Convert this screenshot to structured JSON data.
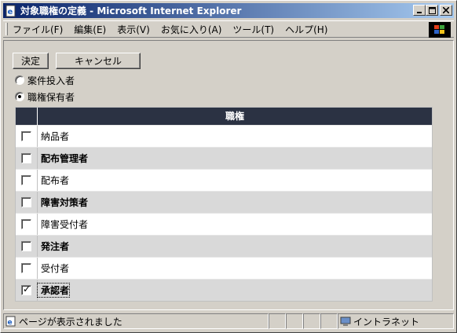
{
  "window": {
    "title": "対象職権の定義 - Microsoft Internet Explorer",
    "icon": "ie-page-icon"
  },
  "menubar": {
    "items": [
      "ファイル(F)",
      "編集(E)",
      "表示(V)",
      "お気に入り(A)",
      "ツール(T)",
      "ヘルプ(H)"
    ]
  },
  "actions": {
    "ok_label": "決定",
    "cancel_label": "キャンセル"
  },
  "radios": [
    {
      "label": "案件投入者",
      "checked": false
    },
    {
      "label": "職権保有者",
      "checked": true
    }
  ],
  "table": {
    "header": "職権",
    "rows": [
      {
        "label": "納品者",
        "checked": false
      },
      {
        "label": "配布管理者",
        "checked": false
      },
      {
        "label": "配布者",
        "checked": false
      },
      {
        "label": "障害対策者",
        "checked": false
      },
      {
        "label": "障害受付者",
        "checked": false
      },
      {
        "label": "発注者",
        "checked": false
      },
      {
        "label": "受付者",
        "checked": false
      },
      {
        "label": "承認者",
        "checked": true
      }
    ]
  },
  "status": {
    "message": "ページが表示されました",
    "zone": "イントラネット"
  },
  "colors": {
    "titlebar_start": "#0a246a",
    "titlebar_end": "#a6caf0",
    "table_header": "#2b3243",
    "row_alt": "#d9d9d9"
  }
}
